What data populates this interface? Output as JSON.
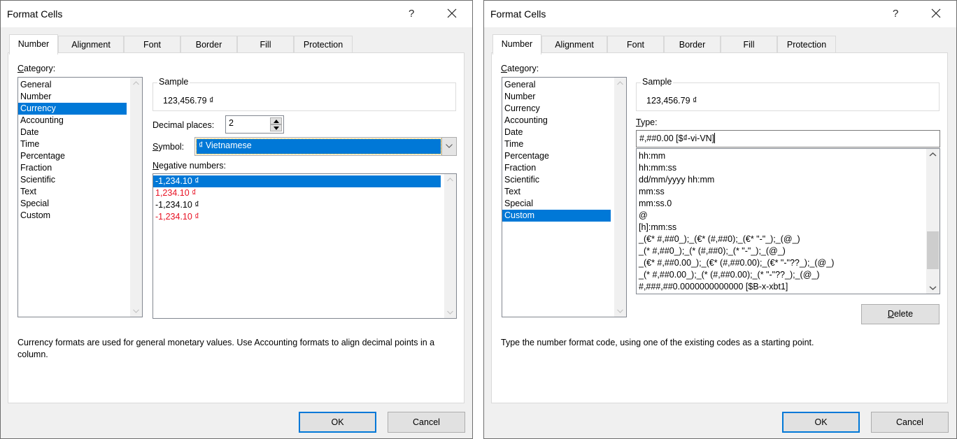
{
  "dialogs": [
    {
      "title": "Format Cells",
      "help_label": "?",
      "tabs": [
        "Number",
        "Alignment",
        "Font",
        "Border",
        "Fill",
        "Protection"
      ],
      "active_tab": "Number",
      "category_label": "Category:",
      "categories": [
        "General",
        "Number",
        "Currency",
        "Accounting",
        "Date",
        "Time",
        "Percentage",
        "Fraction",
        "Scientific",
        "Text",
        "Special",
        "Custom"
      ],
      "selected_category": "Currency",
      "sample_label": "Sample",
      "sample_value": "123,456.79 ₫",
      "decimal_places_label": "Decimal places:",
      "decimal_places_value": "2",
      "symbol_label": "Symbol:",
      "symbol_value": "₫ Vietnamese",
      "negative_numbers_label": "Negative numbers:",
      "negative_numbers": [
        {
          "text": "-1,234.10 ₫",
          "color": "selected"
        },
        {
          "text": "1,234.10 ₫",
          "color": "red"
        },
        {
          "text": "-1,234.10 ₫",
          "color": "black"
        },
        {
          "text": "-1,234.10 ₫",
          "color": "red"
        }
      ],
      "description": "Currency formats are used for general monetary values.  Use Accounting formats to align decimal points in a column.",
      "ok_label": "OK",
      "cancel_label": "Cancel"
    },
    {
      "title": "Format Cells",
      "help_label": "?",
      "tabs": [
        "Number",
        "Alignment",
        "Font",
        "Border",
        "Fill",
        "Protection"
      ],
      "active_tab": "Number",
      "category_label": "Category:",
      "categories": [
        "General",
        "Number",
        "Currency",
        "Accounting",
        "Date",
        "Time",
        "Percentage",
        "Fraction",
        "Scientific",
        "Text",
        "Special",
        "Custom"
      ],
      "selected_category": "Custom",
      "sample_label": "Sample",
      "sample_value": "123,456.79 ₫",
      "type_label": "Type:",
      "type_value": "#,##0.00 [$₫-vi-VN]",
      "type_list": [
        "hh:mm",
        "hh:mm:ss",
        "dd/mm/yyyy hh:mm",
        "mm:ss",
        "mm:ss.0",
        "@",
        "[h]:mm:ss",
        "_(€* #,##0_);_(€* (#,##0);_(€* \"-\"_);_(@_)",
        "_(* #,##0_);_(* (#,##0);_(* \"-\"_);_(@_)",
        "_(€* #,##0.00_);_(€* (#,##0.00);_(€* \"-\"??_);_(@_)",
        "_(* #,##0.00_);_(* (#,##0.00);_(* \"-\"??_);_(@_)",
        "#,###,##0.0000000000000 [$B-x-xbt1]"
      ],
      "type_list_scroll_position": 0.85,
      "delete_label": "Delete",
      "description": "Type the number format code, using one of the existing codes as a starting point.",
      "ok_label": "OK",
      "cancel_label": "Cancel"
    }
  ],
  "colors": {
    "selection": "#0078d7",
    "negative_red": "#e81123",
    "dialog_bg": "#f0f0f0",
    "default_button_border": "#0078d7"
  }
}
